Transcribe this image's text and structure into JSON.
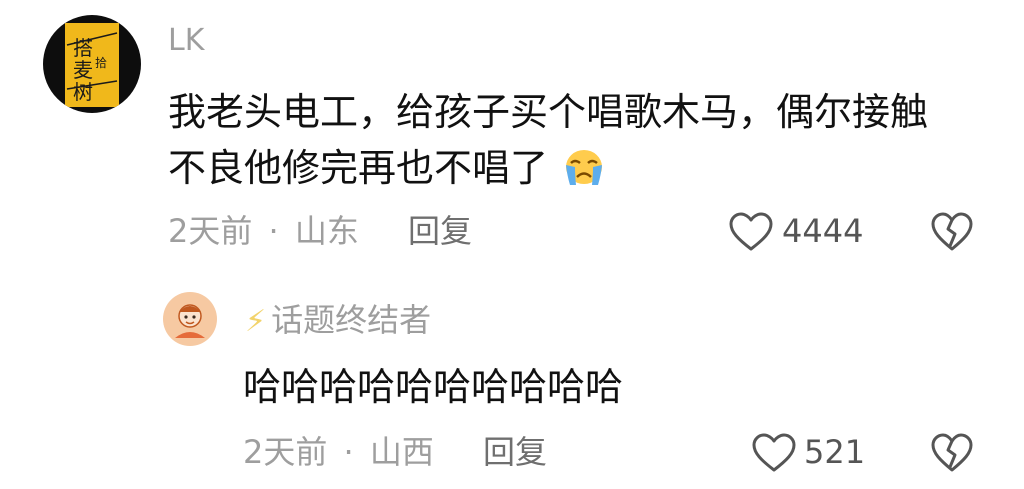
{
  "comment": {
    "username": "LK",
    "text_line1": "我老头电工，给孩子买个唱歌木马，偶尔接触",
    "text_line2": "不良他修完再也不唱了",
    "emoji": "crying-face",
    "time": "2天前",
    "separator": "·",
    "location": "山东",
    "reply_label": "回复",
    "like_count": "4444"
  },
  "reply": {
    "badge": "⚡",
    "username": "话题终结者",
    "text": "哈哈哈哈哈哈哈哈哈哈",
    "time": "2天前",
    "separator": "·",
    "location": "山西",
    "reply_label": "回复",
    "like_count": "521"
  },
  "colors": {
    "meta_gray": "#9e9e9e",
    "badge_yellow": "#f2d36b",
    "avatar1_bg": "#0d0d0d",
    "avatar1_gold": "#f0b81b",
    "avatar2_bg": "#f6c9a2"
  }
}
